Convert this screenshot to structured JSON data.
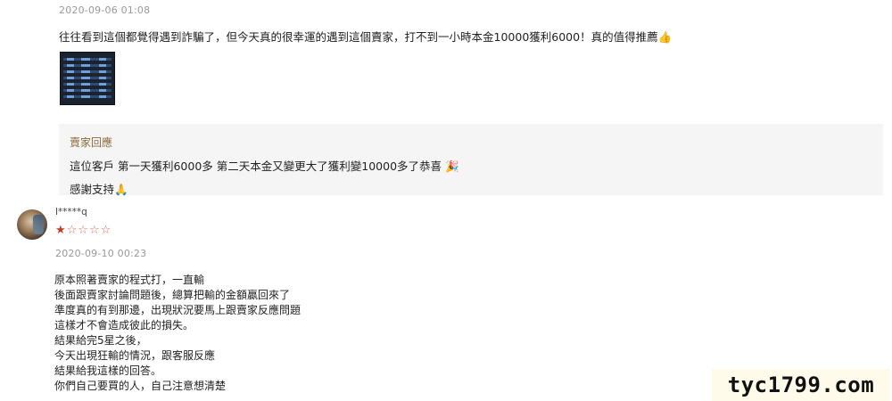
{
  "review1": {
    "date": "2020-09-06 01:08",
    "text": "往往看到這個都覺得遇到詐騙了，但今天真的很幸運的遇到這個賣家，打不到一小時本金10000獲利6000！真的值得推薦👍"
  },
  "seller_reply": {
    "title": "賣家回應",
    "line1": "這位客戶 第一天獲利6000多 第二天本金又變更大了獲利變10000多了恭喜 🎉",
    "line2": "感謝支持🙏"
  },
  "review2": {
    "username": "l*****q",
    "rating": 1,
    "max_rating": 5,
    "stars": {
      "filled": "★",
      "empty": "☆☆☆☆"
    },
    "date": "2020-09-10 00:23",
    "lines": [
      "原本照著賣家的程式打，一直輸",
      "後面跟賣家討論問題後，總算把輸的金額贏回來了",
      "準度真的有到那邊，出現狀況要馬上跟賣家反應問題",
      "這樣才不會造成彼此的損失。",
      "結果給完5星之後，",
      "今天出現狂輸的情況，跟客服反應",
      "結果給我這樣的回答。",
      "你們自己要買的人，自己注意想清楚"
    ]
  },
  "watermark": {
    "text": "tyc1799.com"
  }
}
